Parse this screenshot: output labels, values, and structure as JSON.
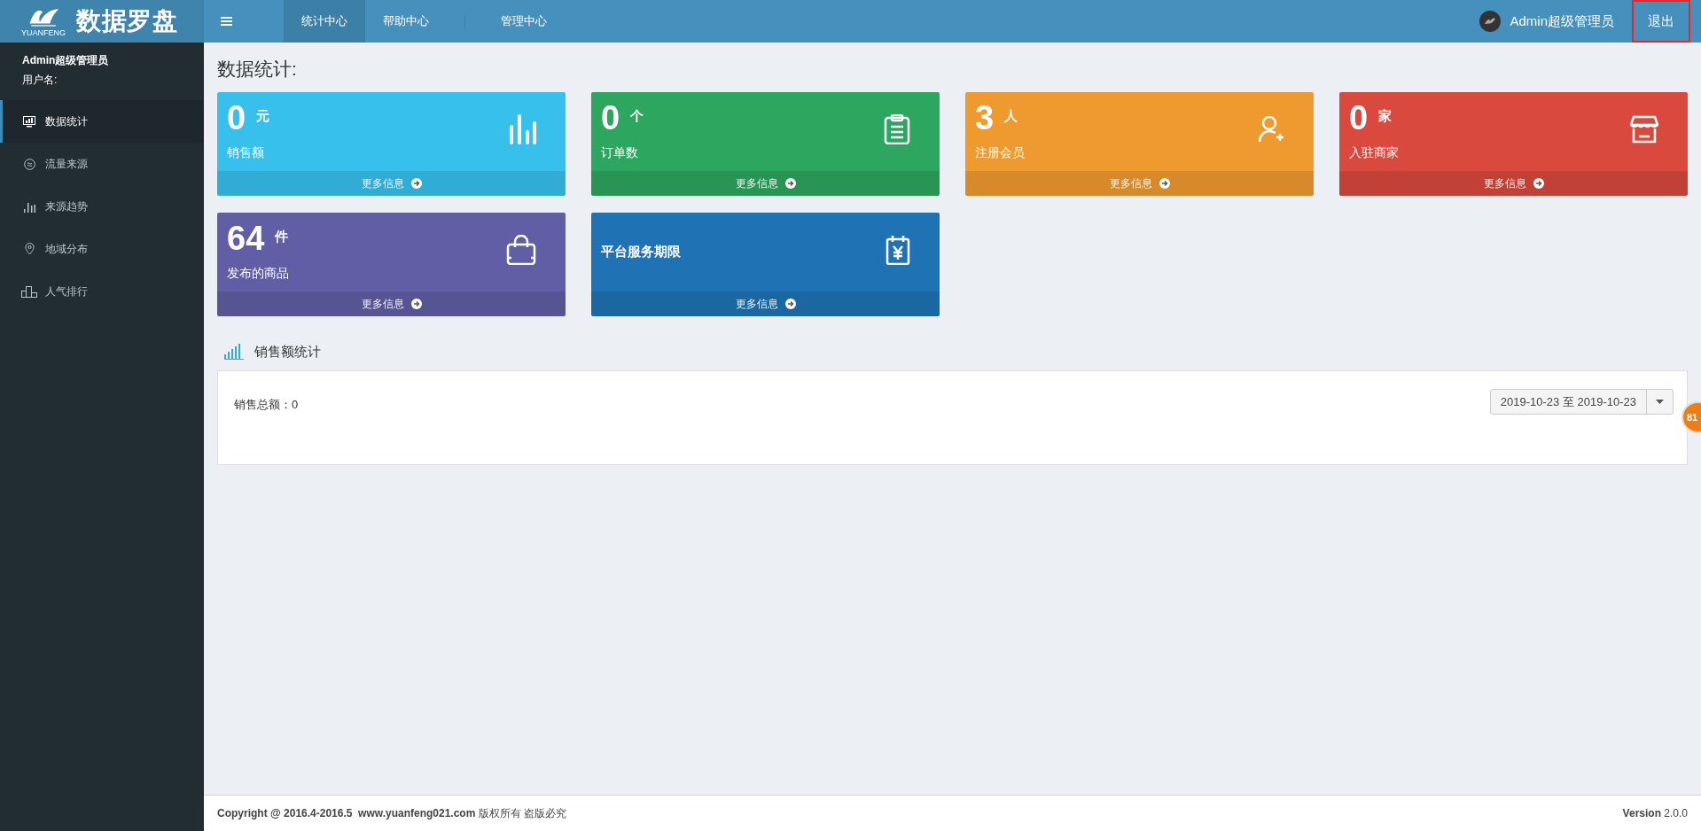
{
  "logo": {
    "title": "数据罗盘",
    "subtitle": "YUANFENG"
  },
  "nav": [
    {
      "label": "统计中心",
      "selected": true
    },
    {
      "label": "帮助中心",
      "selected": false
    },
    {
      "label": "管理中心",
      "selected": false
    }
  ],
  "user": {
    "name": "Admin超级管理员",
    "logout": "退出",
    "logout_highlighted": true
  },
  "sidebar": {
    "user_name": "Admin超级管理员",
    "user_label": "用户名:",
    "items": [
      {
        "label": "数据统计",
        "selected": true
      },
      {
        "label": "流量来源",
        "selected": false
      },
      {
        "label": "来源趋势",
        "selected": false
      },
      {
        "label": "地域分布",
        "selected": false
      },
      {
        "label": "人气排行",
        "selected": false
      }
    ]
  },
  "page_title": "数据统计:",
  "cards": [
    {
      "kind": "stat",
      "value": "0",
      "unit": "元",
      "label": "销售额",
      "more": "更多信息",
      "color": "#37c0ec"
    },
    {
      "kind": "stat",
      "value": "0",
      "unit": "个",
      "label": "订单数",
      "more": "更多信息",
      "color": "#2da65f"
    },
    {
      "kind": "stat",
      "value": "3",
      "unit": "人",
      "label": "注册会员",
      "more": "更多信息",
      "color": "#ef9a2e"
    },
    {
      "kind": "stat",
      "value": "0",
      "unit": "家",
      "label": "入驻商家",
      "more": "更多信息",
      "color": "#d9493d"
    },
    {
      "kind": "stat",
      "value": "64",
      "unit": "件",
      "label": "发布的商品",
      "more": "更多信息",
      "color": "#615ea5"
    },
    {
      "kind": "title",
      "label": "平台服务期限",
      "more": "更多信息",
      "color": "#1f73b4"
    }
  ],
  "sales": {
    "title": "销售额统计",
    "total": "销售总额：0",
    "date_range": "2019-10-23 至 2019-10-23"
  },
  "float_badge": "81",
  "footer": {
    "copyright": "**Copyright @ 2016.4-2016.5  www.yuanfeng021.com** 版权所有 盗版必究",
    "version": "**Version** 2.0.0"
  }
}
